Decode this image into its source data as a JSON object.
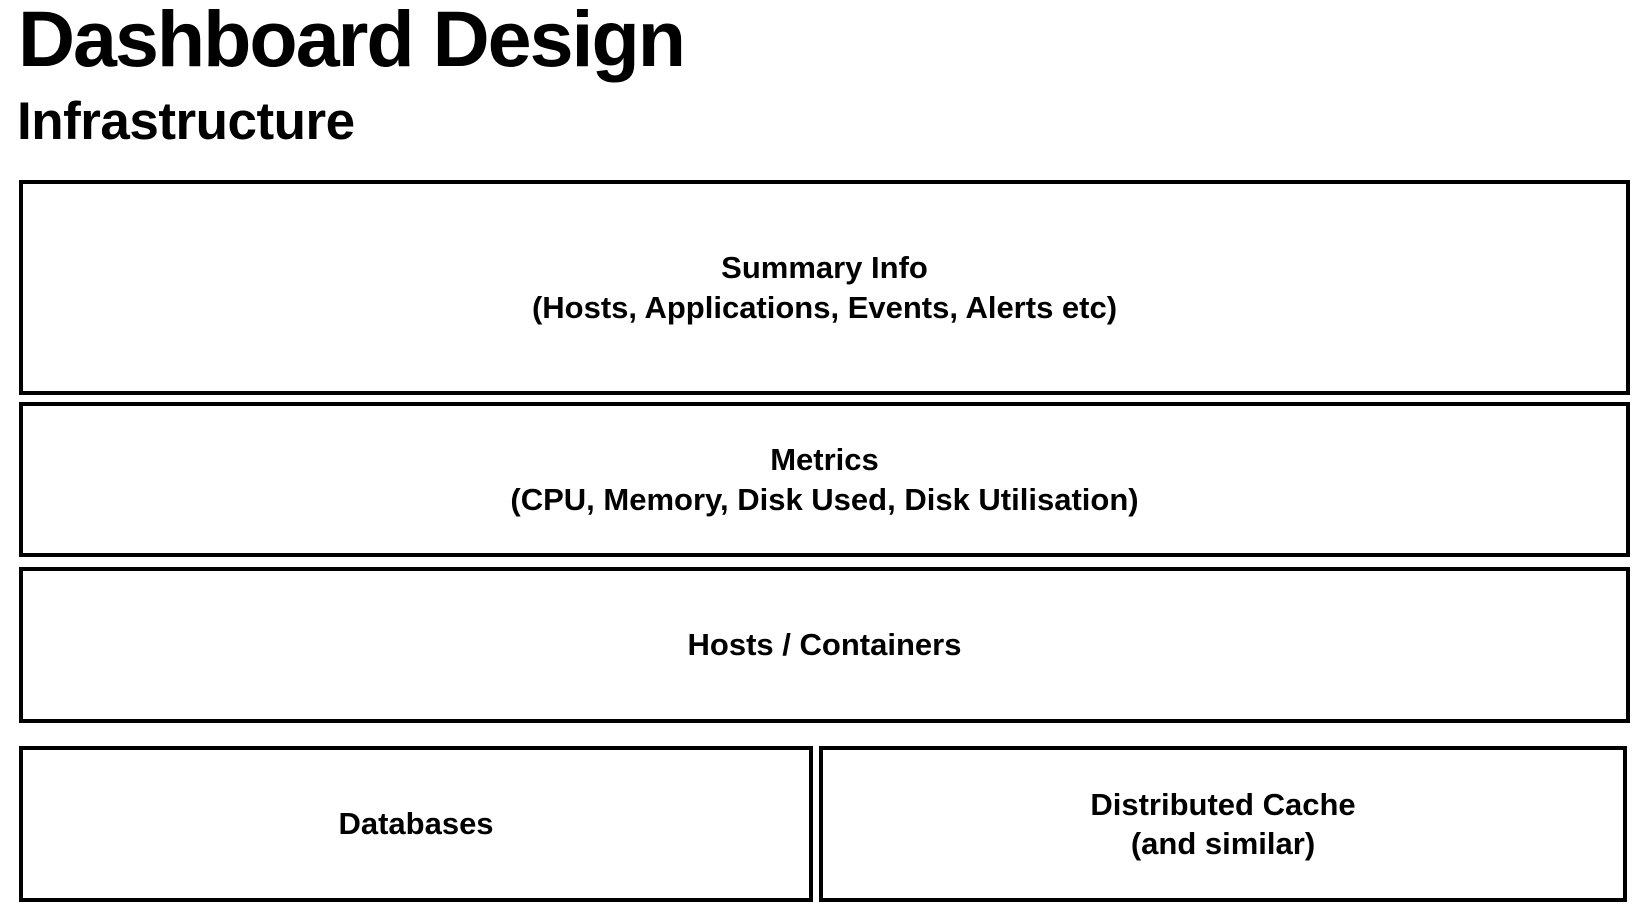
{
  "title": "Dashboard Design",
  "subtitle": "Infrastructure",
  "panels": {
    "summary": {
      "title": "Summary Info",
      "detail": "(Hosts, Applications, Events, Alerts etc)"
    },
    "metrics": {
      "title": "Metrics",
      "detail": "(CPU, Memory, Disk Used, Disk Utilisation)"
    },
    "hosts": {
      "title": "Hosts / Containers"
    },
    "databases": {
      "title": "Databases"
    },
    "cache": {
      "title": "Distributed Cache",
      "detail": "(and similar)"
    }
  }
}
